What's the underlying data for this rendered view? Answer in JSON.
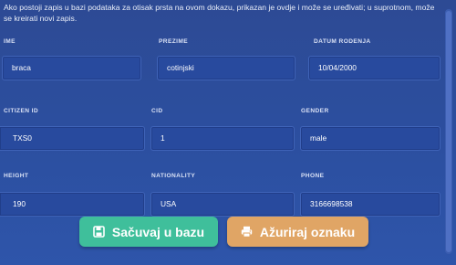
{
  "info_text": "Ako postoji zapis u bazi podataka za otisak prsta na ovom dokazu, prikazan je ovdje i može se uređivati; u suprotnom, može se kreirati novi zapis.",
  "fields": {
    "ime": {
      "label": "IME",
      "value": "braca"
    },
    "prezime": {
      "label": "PREZIME",
      "value": "cotinjski"
    },
    "datum_rodenja": {
      "label": "DATUM RODENJA",
      "value": "10/04/2000"
    },
    "citizen_id": {
      "label": "CITIZEN ID",
      "value": "TXS0"
    },
    "cid": {
      "label": "CID",
      "value": "1"
    },
    "gender": {
      "label": "GENDER",
      "value": "male"
    },
    "height": {
      "label": "HEIGHT",
      "value": "190"
    },
    "nationality": {
      "label": "NATIONALITY",
      "value": "USA"
    },
    "phone": {
      "label": "PHONE",
      "value": "3166698538"
    }
  },
  "buttons": {
    "save": {
      "label": "Sačuvaj u bazu",
      "icon": "floppy-disk-icon",
      "color": "#3fbf9b"
    },
    "update": {
      "label": "Ažuriraj oznaku",
      "icon": "printer-icon",
      "color": "#e0a565"
    }
  },
  "colors": {
    "background": "#2d4a94",
    "field_background": "#284a9e",
    "field_border": "#3f63b8"
  }
}
